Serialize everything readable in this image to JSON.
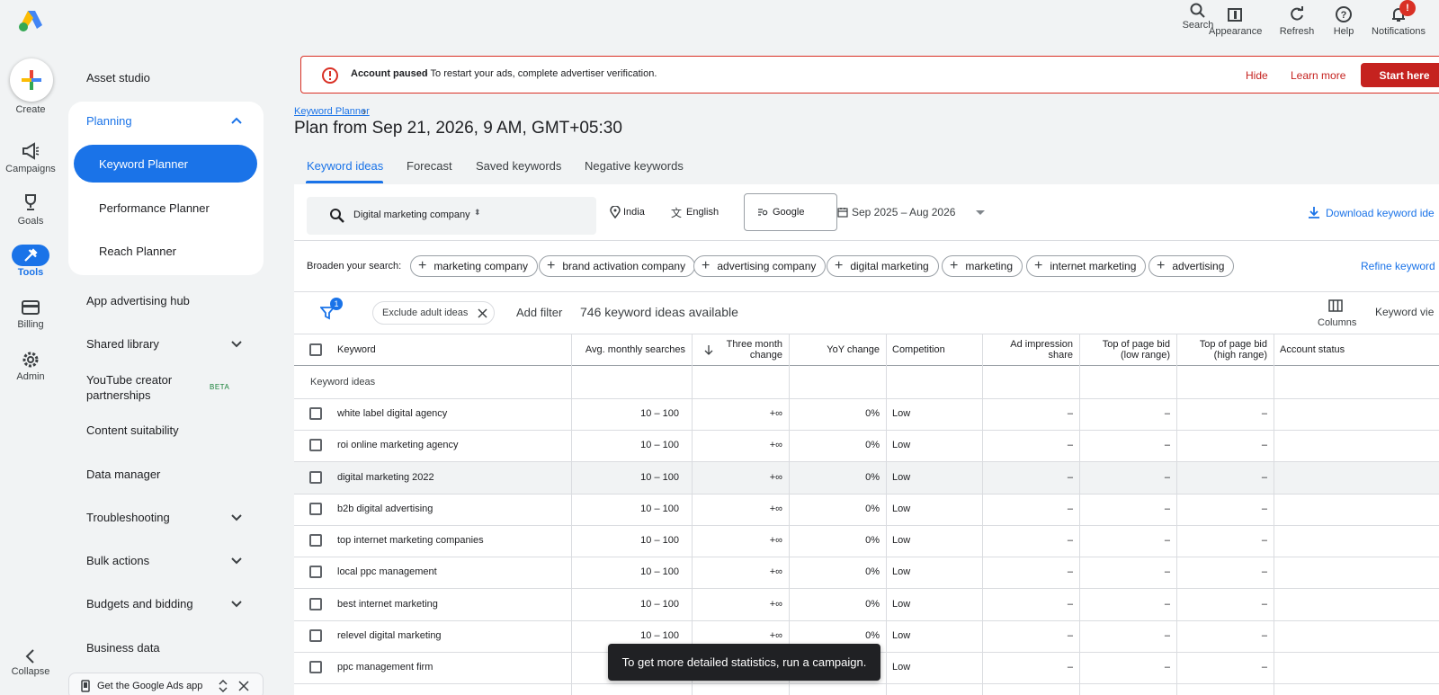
{
  "rail": {
    "create": "Create",
    "items": [
      "Campaigns",
      "Goals",
      "Tools",
      "Billing",
      "Admin"
    ],
    "collapse": "Collapse"
  },
  "nav": {
    "asset_studio": "Asset studio",
    "planning": "Planning",
    "planning_items": [
      "Keyword Planner",
      "Performance Planner",
      "Reach Planner"
    ],
    "items": [
      "App advertising hub",
      "Shared library",
      "YouTube creator partnerships",
      "Content suitability",
      "Data manager",
      "Troubleshooting",
      "Bulk actions",
      "Budgets and bidding",
      "Business data"
    ],
    "beta_badge": "BETA",
    "app_banner": "Get the Google Ads app"
  },
  "topbar": {
    "search": "Search",
    "appearance": "Appearance",
    "refresh": "Refresh",
    "help": "Help",
    "notifications": "Notifications",
    "notif_badge": "!"
  },
  "alert": {
    "title": "Account paused",
    "message": " - To restart your ads, complete advertiser verification.",
    "hide": "Hide",
    "learn_more": "Learn more",
    "start_here": "Start here"
  },
  "page": {
    "breadcrumb": "Keyword Planner",
    "title": "Plan from Sep 21, 2026, 9 AM, GMT+05:30",
    "tabs": [
      "Keyword ideas",
      "Forecast",
      "Saved keywords",
      "Negative keywords"
    ]
  },
  "search": {
    "query": "Digital marketing company",
    "location": "India",
    "language": "English",
    "network": "Google",
    "date_range": "Sep 2025 – Aug 2026",
    "download": "Download keyword ide"
  },
  "broaden": {
    "label": "Broaden your search:",
    "chips": [
      "marketing company",
      "brand activation company",
      "advertising company",
      "digital marketing",
      "marketing",
      "internet marketing",
      "advertising"
    ],
    "refine": "Refine keyword"
  },
  "filters": {
    "badge": "1",
    "exclude_adult": "Exclude adult ideas",
    "add_filter": "Add filter",
    "count": "746 keyword ideas available",
    "columns": "Columns",
    "keyword_view": "Keyword vie"
  },
  "table": {
    "headers": {
      "keyword": "Keyword",
      "avg": "Avg. monthly searches",
      "three_month_1": "Three month",
      "three_month_2": "change",
      "yoy": "YoY change",
      "competition": "Competition",
      "ad_imp_1": "Ad impression",
      "ad_imp_2": "share",
      "bid_low_1": "Top of page bid",
      "bid_low_2": "(low range)",
      "bid_high_1": "Top of page bid",
      "bid_high_2": "(high range)",
      "status": "Account status"
    },
    "group_label": "Keyword ideas",
    "rows": [
      {
        "keyword": "white label digital agency",
        "avg": "10 – 100",
        "three": "+∞",
        "yoy": "0%",
        "comp": "Low",
        "imp": "–",
        "low": "–",
        "high": "–"
      },
      {
        "keyword": "roi online marketing agency",
        "avg": "10 – 100",
        "three": "+∞",
        "yoy": "0%",
        "comp": "Low",
        "imp": "–",
        "low": "–",
        "high": "–"
      },
      {
        "keyword": "digital marketing 2022",
        "avg": "10 – 100",
        "three": "+∞",
        "yoy": "0%",
        "comp": "Low",
        "imp": "–",
        "low": "–",
        "high": "–"
      },
      {
        "keyword": "b2b digital advertising",
        "avg": "10 – 100",
        "three": "+∞",
        "yoy": "0%",
        "comp": "Low",
        "imp": "–",
        "low": "–",
        "high": "–"
      },
      {
        "keyword": "top internet marketing companies",
        "avg": "10 – 100",
        "three": "+∞",
        "yoy": "0%",
        "comp": "Low",
        "imp": "–",
        "low": "–",
        "high": "–"
      },
      {
        "keyword": "local ppc management",
        "avg": "10 – 100",
        "three": "+∞",
        "yoy": "0%",
        "comp": "Low",
        "imp": "–",
        "low": "–",
        "high": "–"
      },
      {
        "keyword": "best internet marketing",
        "avg": "10 – 100",
        "three": "+∞",
        "yoy": "0%",
        "comp": "Low",
        "imp": "–",
        "low": "–",
        "high": "–"
      },
      {
        "keyword": "relevel digital marketing",
        "avg": "10 – 100",
        "three": "+∞",
        "yoy": "0%",
        "comp": "Low",
        "imp": "–",
        "low": "–",
        "high": "–"
      },
      {
        "keyword": "ppc management firm",
        "avg": "",
        "three": "",
        "yoy": "",
        "comp": "Low",
        "imp": "–",
        "low": "–",
        "high": "–"
      }
    ]
  },
  "toast": "To get more detailed statistics, run a campaign."
}
